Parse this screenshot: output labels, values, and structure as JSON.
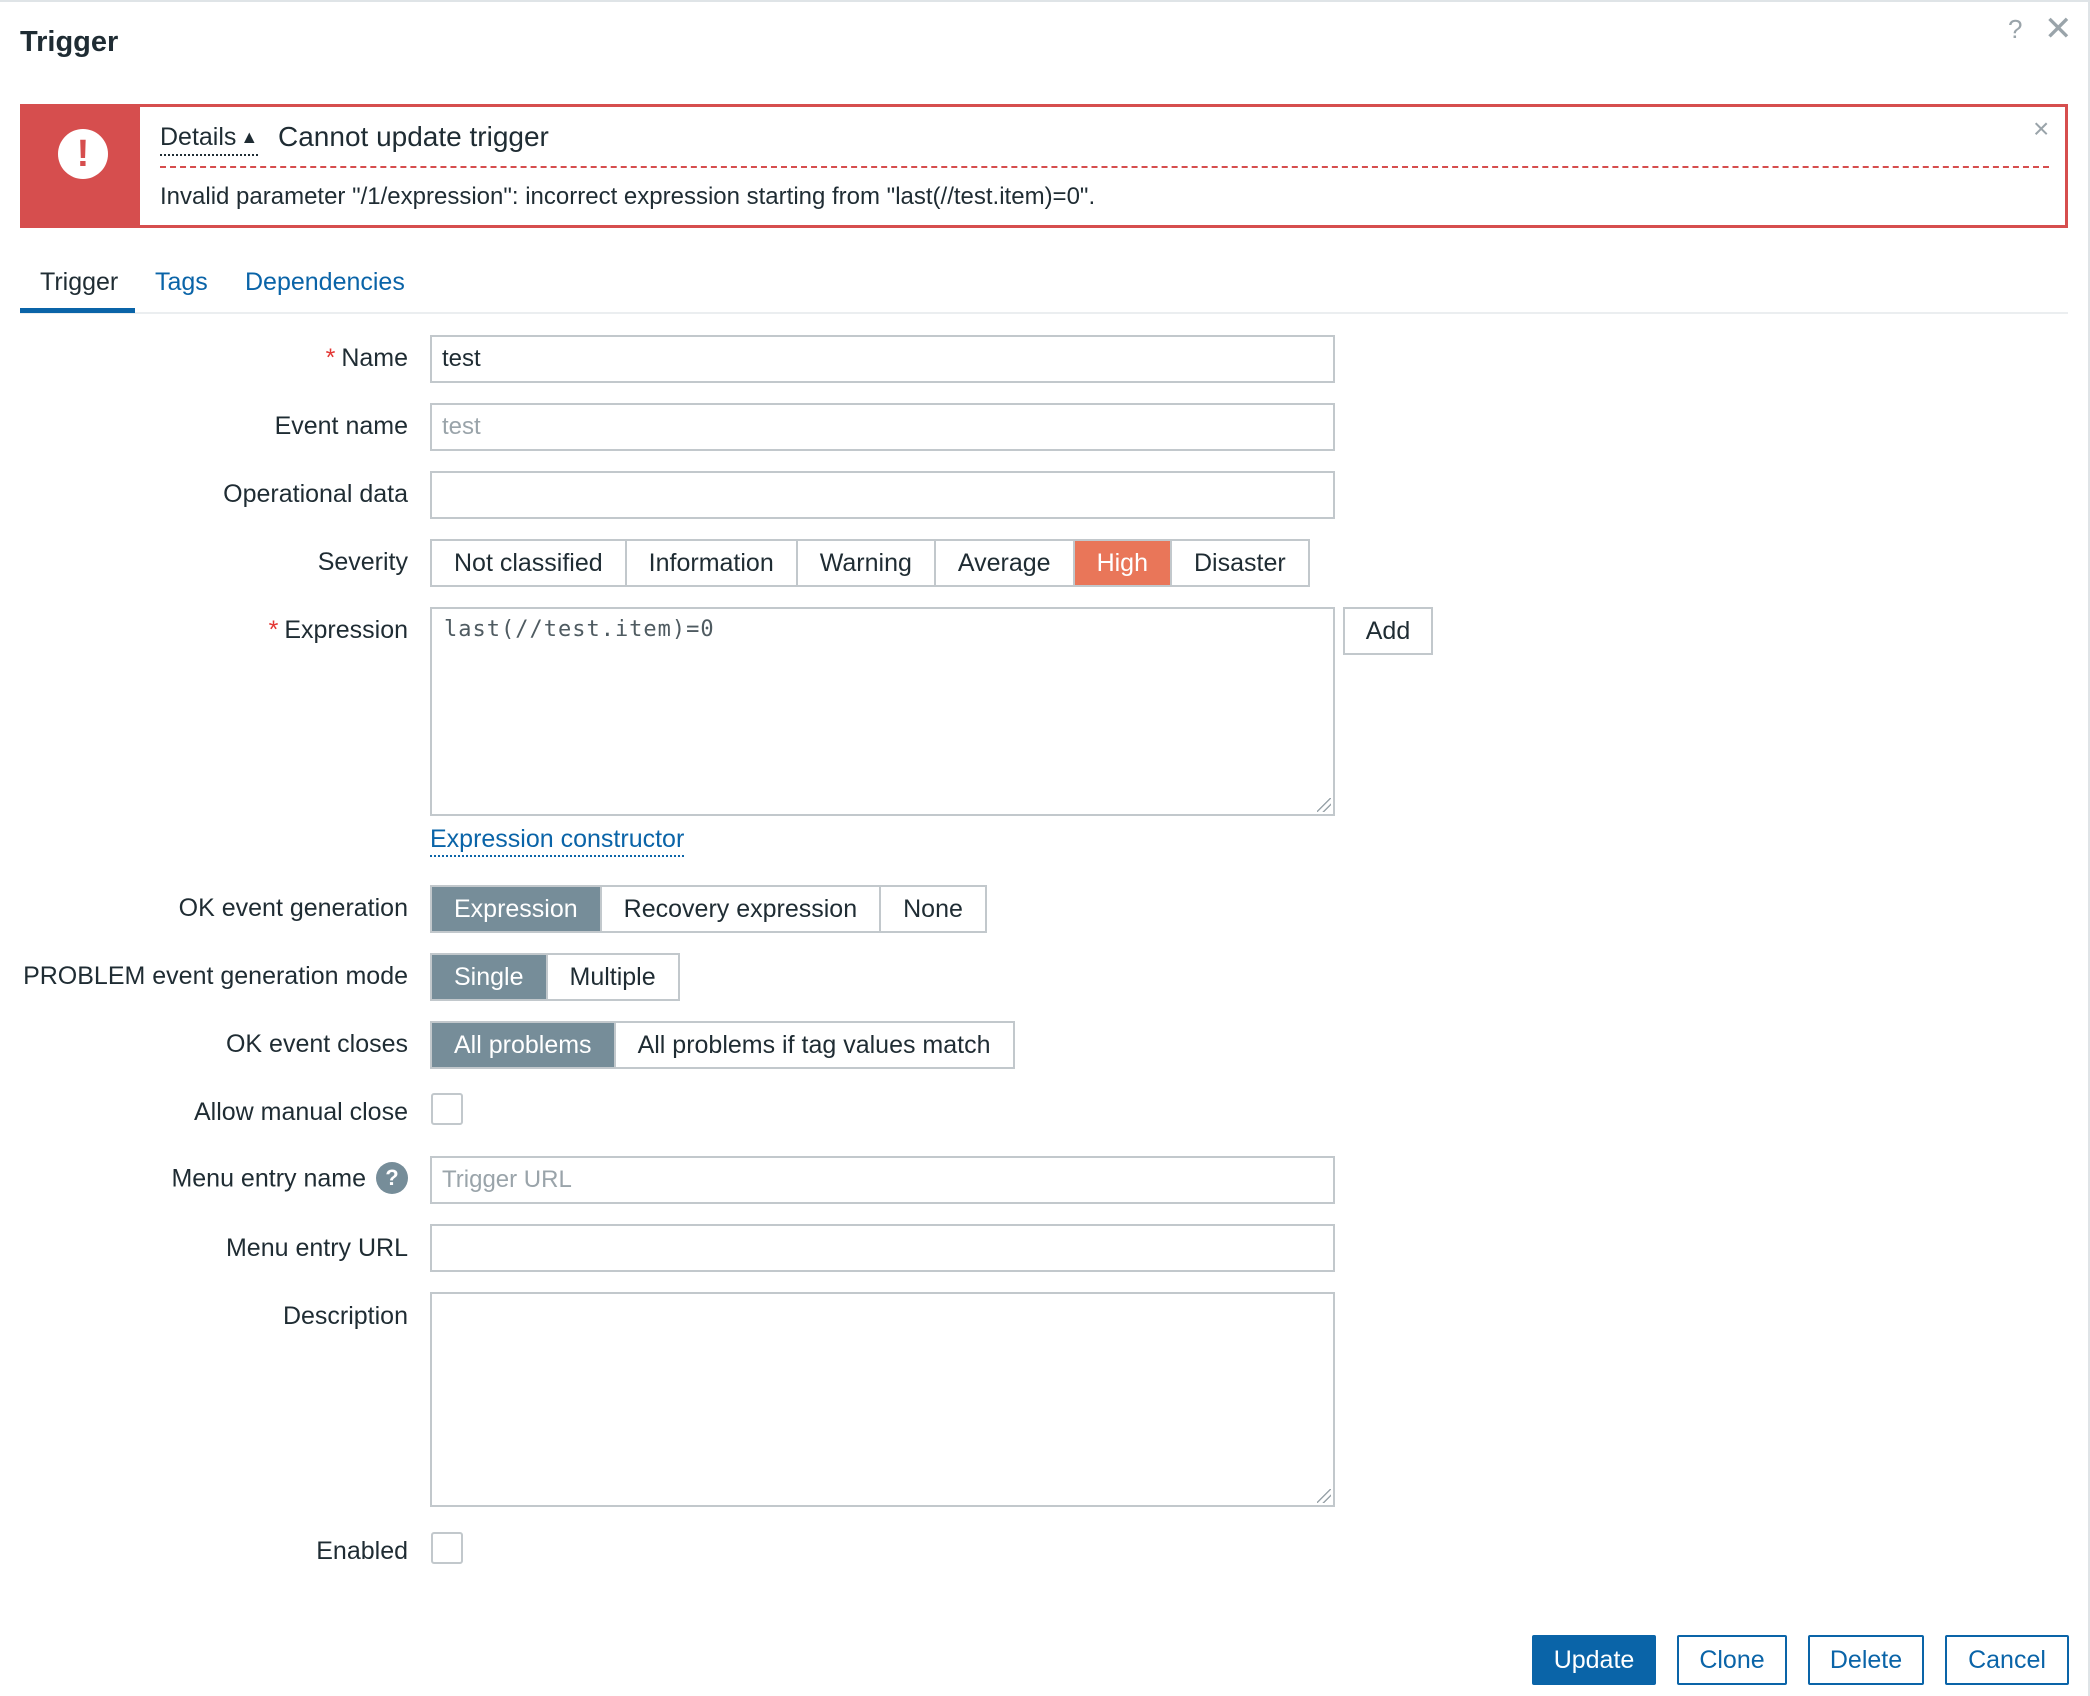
{
  "dialog": {
    "title": "Trigger",
    "help_glyph": "?",
    "close_glyph": "✕"
  },
  "message": {
    "details_label": "Details",
    "details_arrow": "▲",
    "title": "Cannot update trigger",
    "text": "Invalid parameter \"/1/expression\": incorrect expression starting from \"last(//test.item)=0\".",
    "close_glyph": "×",
    "icon_glyph": "!"
  },
  "tabs": [
    {
      "label": "Trigger",
      "active": true
    },
    {
      "label": "Tags",
      "active": false
    },
    {
      "label": "Dependencies",
      "active": false
    }
  ],
  "form": {
    "name": {
      "label": "Name",
      "required_mark": "*",
      "value": "test"
    },
    "event_name": {
      "label": "Event name",
      "value": "",
      "placeholder": "test"
    },
    "operational_data": {
      "label": "Operational data",
      "value": ""
    },
    "severity": {
      "label": "Severity",
      "options": [
        "Not classified",
        "Information",
        "Warning",
        "Average",
        "High",
        "Disaster"
      ],
      "selected": "High"
    },
    "expression": {
      "label": "Expression",
      "required_mark": "*",
      "value": "last(//test.item)=0",
      "add_label": "Add"
    },
    "expression_constructor": "Expression constructor",
    "ok_event_generation": {
      "label": "OK event generation",
      "options": [
        "Expression",
        "Recovery expression",
        "None"
      ],
      "selected": "Expression"
    },
    "problem_event_mode": {
      "label": "PROBLEM event generation mode",
      "options": [
        "Single",
        "Multiple"
      ],
      "selected": "Single"
    },
    "ok_event_closes": {
      "label": "OK event closes",
      "options": [
        "All problems",
        "All problems if tag values match"
      ],
      "selected": "All problems"
    },
    "allow_manual_close": {
      "label": "Allow manual close",
      "checked": false
    },
    "menu_entry_name": {
      "label": "Menu entry name",
      "value": "",
      "placeholder": "Trigger URL",
      "help_glyph": "?"
    },
    "menu_entry_url": {
      "label": "Menu entry URL",
      "value": ""
    },
    "description": {
      "label": "Description",
      "value": ""
    },
    "enabled": {
      "label": "Enabled",
      "checked": false
    }
  },
  "footer": {
    "update": "Update",
    "clone": "Clone",
    "delete": "Delete",
    "cancel": "Cancel"
  },
  "colors": {
    "primary": "#0a64a8",
    "error": "#d64e4e",
    "severity_high": "#e97659",
    "segment_selected": "#768d99"
  }
}
